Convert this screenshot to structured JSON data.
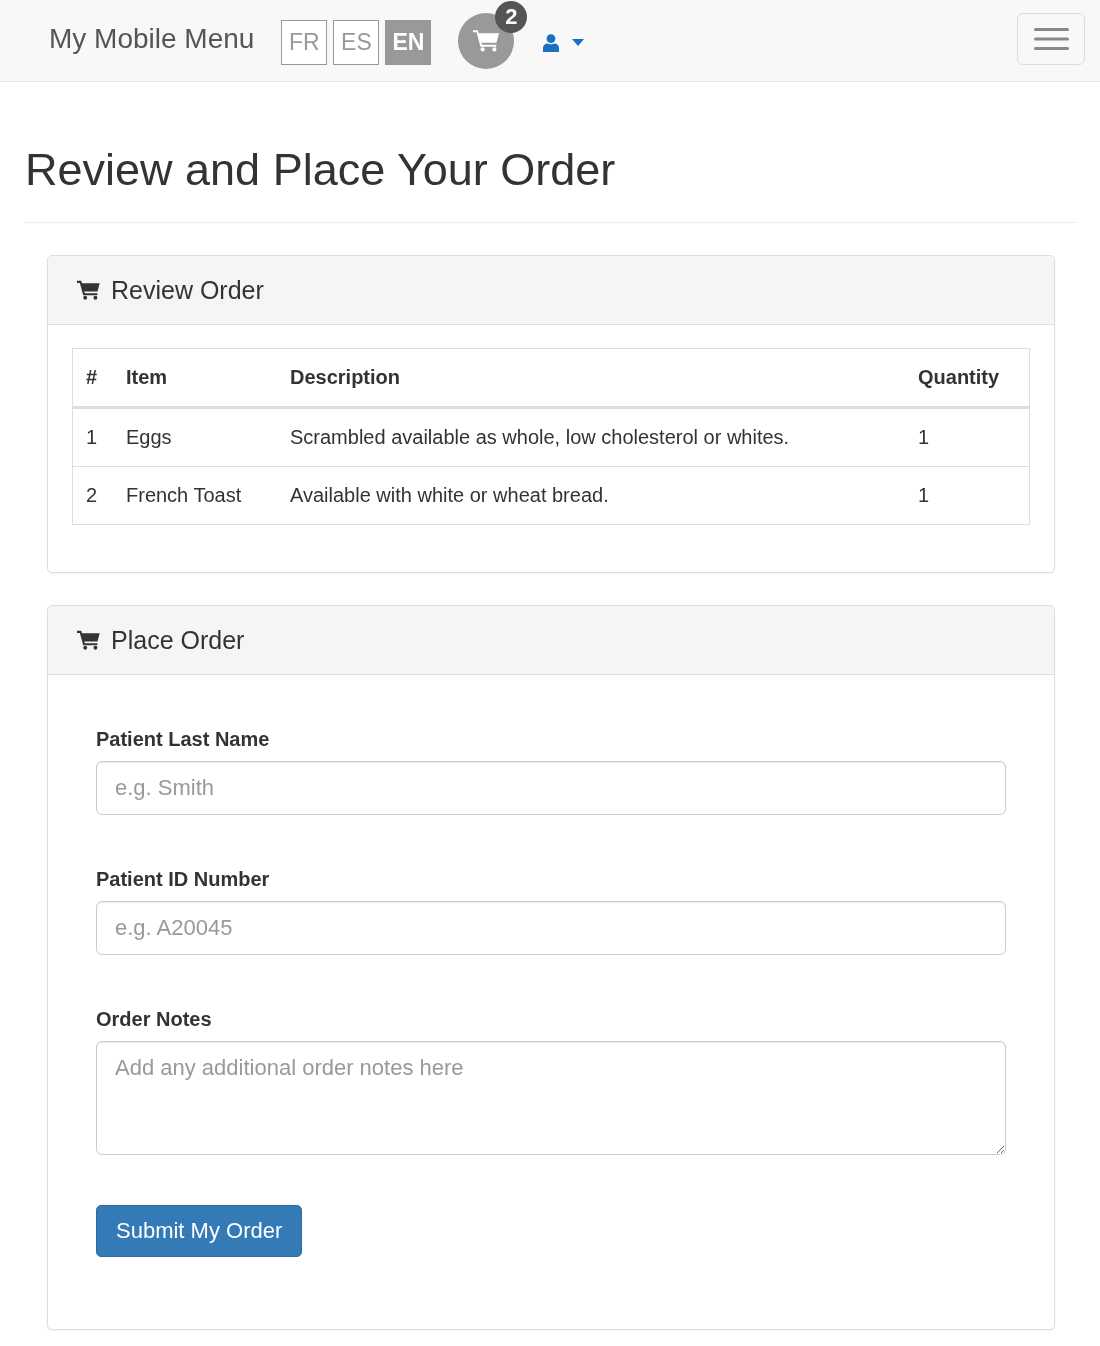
{
  "navbar": {
    "brand": "My Mobile Menu",
    "languages": [
      {
        "label": "FR",
        "selected": false
      },
      {
        "label": "ES",
        "selected": false
      },
      {
        "label": "EN",
        "selected": true
      }
    ],
    "cart_count": "2"
  },
  "page_title": "Review and Place Your Order",
  "review_panel": {
    "title": "Review Order",
    "table": {
      "columns": [
        "#",
        "Item",
        "Description",
        "Quantity"
      ],
      "rows": [
        [
          "1",
          "Eggs",
          "Scrambled available as whole, low cholesterol or whites.",
          "1"
        ],
        [
          "2",
          "French Toast",
          "Available with white or wheat bread.",
          "1"
        ]
      ]
    }
  },
  "place_panel": {
    "title": "Place Order",
    "fields": [
      {
        "kind": "input",
        "label": "Patient Last Name",
        "placeholder": "e.g. Smith"
      },
      {
        "kind": "input",
        "label": "Patient ID Number",
        "placeholder": "e.g. A20045"
      },
      {
        "kind": "textarea",
        "label": "Order Notes",
        "placeholder": "Add any additional order notes here"
      }
    ],
    "submit": "Submit My Order"
  }
}
